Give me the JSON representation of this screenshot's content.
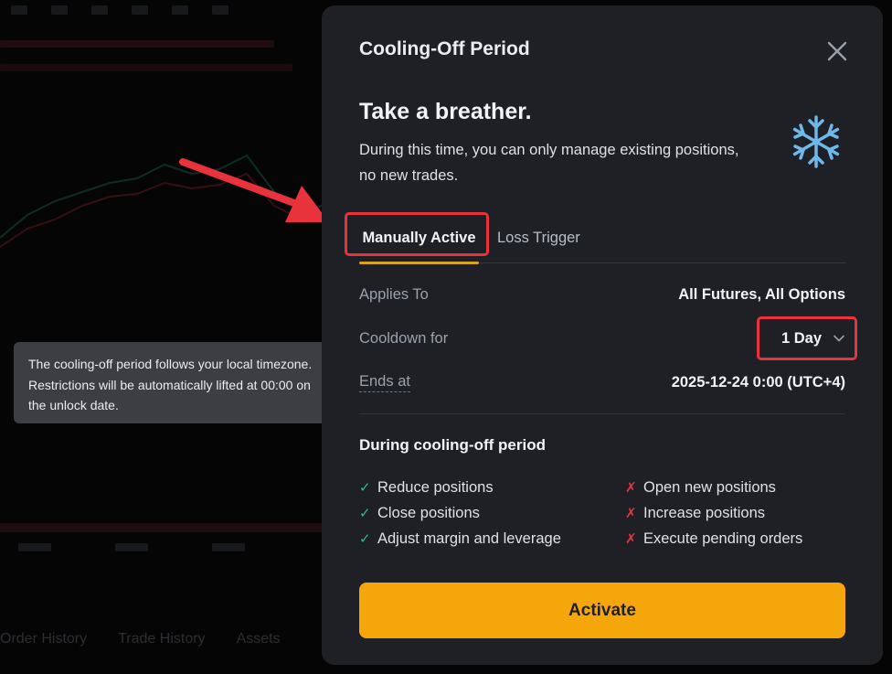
{
  "modal": {
    "title": "Cooling-Off Period",
    "heading": "Take a breather.",
    "description": "During this time, you can only manage existing positions, no new trades.",
    "tabs": [
      {
        "label": "Manually Active",
        "active": true
      },
      {
        "label": "Loss Trigger",
        "active": false
      }
    ],
    "details": {
      "applies_to_label": "Applies To",
      "applies_to_value": "All Futures, All Options",
      "cooldown_label": "Cooldown for",
      "cooldown_value": "1 Day",
      "ends_label": "Ends at",
      "ends_value": "2025-12-24 0:00 (UTC+4)"
    },
    "permissions_title": "During cooling-off period",
    "allowed": [
      "Reduce positions",
      "Close positions",
      "Adjust margin and leverage"
    ],
    "blocked": [
      "Open new positions",
      "Increase positions",
      "Execute pending orders"
    ],
    "allowed_mark": "✓",
    "blocked_mark": "✗",
    "activate_label": "Activate"
  },
  "tooltip": {
    "text": "The cooling-off period follows your local timezone. Restrictions will be automatically lifted at 00:00 on the unlock date."
  },
  "background": {
    "bottom_tabs": [
      "Order History",
      "Trade History",
      "Assets"
    ]
  },
  "colors": {
    "accent": "#f5a60a",
    "tab_underline": "#d8a31a",
    "allowed": "#2ebd85",
    "blocked": "#e8323c",
    "annotation": "#e8323c",
    "snowflake": "#6fb8ec"
  },
  "icons": {
    "close": "close-icon",
    "snowflake": "snowflake-icon",
    "dropdown": "chevron-down-icon"
  }
}
